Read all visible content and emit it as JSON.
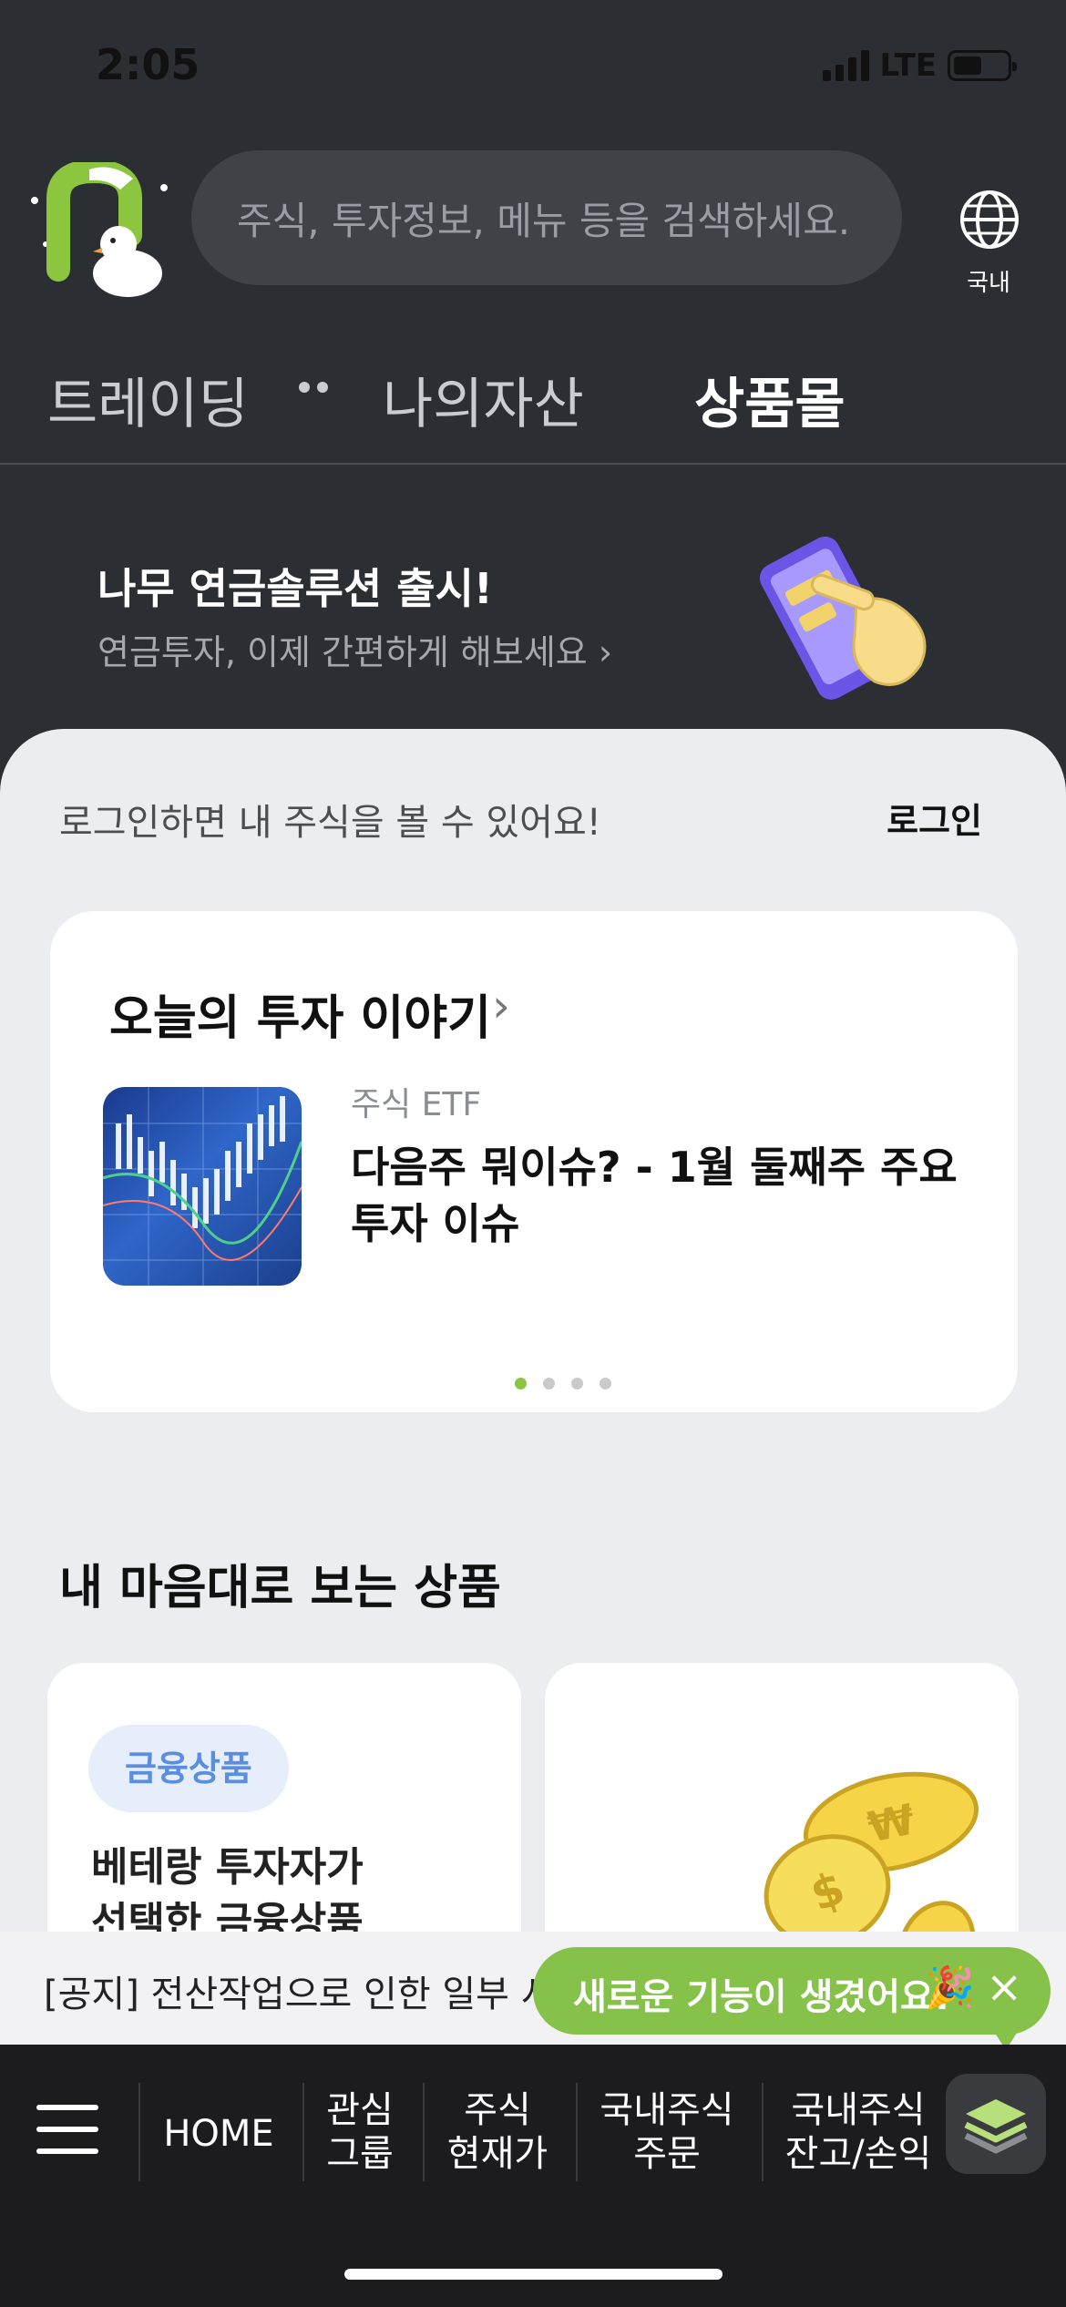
{
  "status": {
    "time": "2:05",
    "network": "LTE"
  },
  "header": {
    "search_placeholder": "주식, 투자정보, 메뉴 등을 검색하세요.",
    "region_label": "국내"
  },
  "tabs": [
    {
      "label": "트레이딩"
    },
    {
      "label": "나의자산"
    },
    {
      "label": "상품몰"
    }
  ],
  "promo": {
    "title": "나무 연금솔루션 출시!",
    "subtitle": "연금투자, 이제 간편하게 해보세요 ›"
  },
  "login": {
    "message": "로그인하면 내 주식을 볼 수 있어요!",
    "button": "로그인"
  },
  "story": {
    "title": "오늘의 투자 이야기",
    "chevron": "›",
    "tag": "주식 ETF",
    "headline": "다음주 뭐이슈? - 1월 둘째주 주요 투자 이슈",
    "pages": 4,
    "active_page": 1
  },
  "products": {
    "section_title": "내 마음대로 보는 상품",
    "card_a": {
      "pill": "금융상품",
      "text_line1": "베테랑 투자자가",
      "text_line2": "선택한 금융상품"
    }
  },
  "notice": {
    "text": "[공지] 전산작업으로 인한 일부 서비",
    "toast": "새로운 기능이 생겼어요!",
    "toast_emoji": "🎉",
    "toast_close": "×"
  },
  "bottom_nav": {
    "home": "HOME",
    "item1_l1": "관심",
    "item1_l2": "그룹",
    "item2_l1": "주식",
    "item2_l2": "현재가",
    "item3_l1": "국내주식",
    "item3_l2": "주문",
    "item4_l1": "국내주식",
    "item4_l2": "잔고/손익"
  },
  "colors": {
    "accent": "#86c14a",
    "bg_dark": "#2b2e33",
    "sheet": "#ecedf0"
  }
}
